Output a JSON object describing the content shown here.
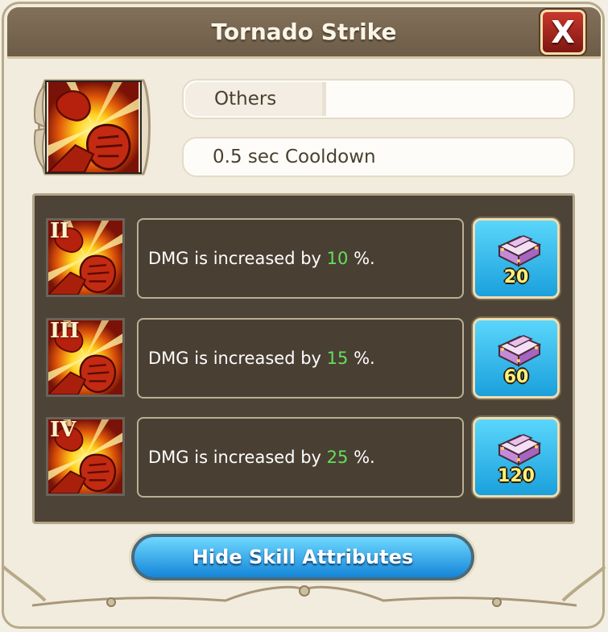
{
  "dialog": {
    "title": "Tornado Strike",
    "close_label": "X"
  },
  "skill": {
    "icon": "fist-punch-icon",
    "type_label": "Others",
    "type_value": "",
    "cooldown": "0.5 sec Cooldown"
  },
  "levels": [
    {
      "roman": "II",
      "prefix": "DMG is increased by",
      "value": "10",
      "suffix": "%.",
      "cost": "20"
    },
    {
      "roman": "III",
      "prefix": "DMG is increased by",
      "value": "15",
      "suffix": "%.",
      "cost": "60"
    },
    {
      "roman": "IV",
      "prefix": "DMG is increased by",
      "value": "25",
      "suffix": "%.",
      "cost": "120"
    }
  ],
  "cost_icon": "skill-book-icon",
  "hide_button": "Hide Skill Attributes",
  "colors": {
    "value_green": "#63e05a",
    "button_blue": "#1aa0dc",
    "title_bar": "#6d5c47",
    "close_red": "#c8372c"
  }
}
